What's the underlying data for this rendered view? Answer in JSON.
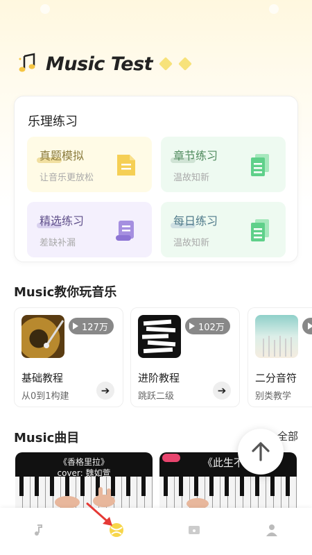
{
  "app": {
    "title": "Music Test"
  },
  "practice": {
    "title": "乐理练习",
    "tiles": [
      {
        "title": "真题模拟",
        "subtitle": "让音乐更放松",
        "icon": "document-icon",
        "bg": "#fffbe6",
        "title_color": "#8a7b3c",
        "accent": "#f5cf55"
      },
      {
        "title": "章节练习",
        "subtitle": "温故知新",
        "icon": "documents-icon",
        "bg": "#eefaf1",
        "title_color": "#4f8a5d",
        "accent": "#5fd08a"
      },
      {
        "title": "精选练习",
        "subtitle": "差缺补漏",
        "icon": "scroll-icon",
        "bg": "#f4f0fd",
        "title_color": "#5f4f8a",
        "accent": "#a58fe0"
      },
      {
        "title": "每日练习",
        "subtitle": "温故知新",
        "icon": "documents-icon",
        "bg": "#eefaf1",
        "title_color": "#4f7a8a",
        "accent": "#5fd08a"
      }
    ]
  },
  "courses": {
    "title": "Music教你玩音乐",
    "items": [
      {
        "name": "基础教程",
        "subtitle": "从0到1构建",
        "views": "127万",
        "thumb": "record-player"
      },
      {
        "name": "进阶教程",
        "subtitle": "跳跃二级",
        "views": "102万",
        "thumb": "piano-keys"
      },
      {
        "name": "二分音符",
        "subtitle": "别类教学",
        "views": "",
        "thumb": "forest"
      }
    ]
  },
  "songs": {
    "title": "Music曲目",
    "view_all": "全部",
    "items": [
      {
        "title": "《香格里拉》\ncover: 魏如萱"
      },
      {
        "title": "《此生不..."
      }
    ]
  },
  "tabbar": {
    "items": [
      {
        "icon": "music-note-icon",
        "active": false
      },
      {
        "icon": "ball-icon",
        "active": true
      },
      {
        "icon": "folder-music-icon",
        "active": false
      },
      {
        "icon": "user-icon",
        "active": false
      }
    ]
  },
  "colors": {
    "accent_yellow": "#f7d64a",
    "arrow_red": "#e53935"
  }
}
